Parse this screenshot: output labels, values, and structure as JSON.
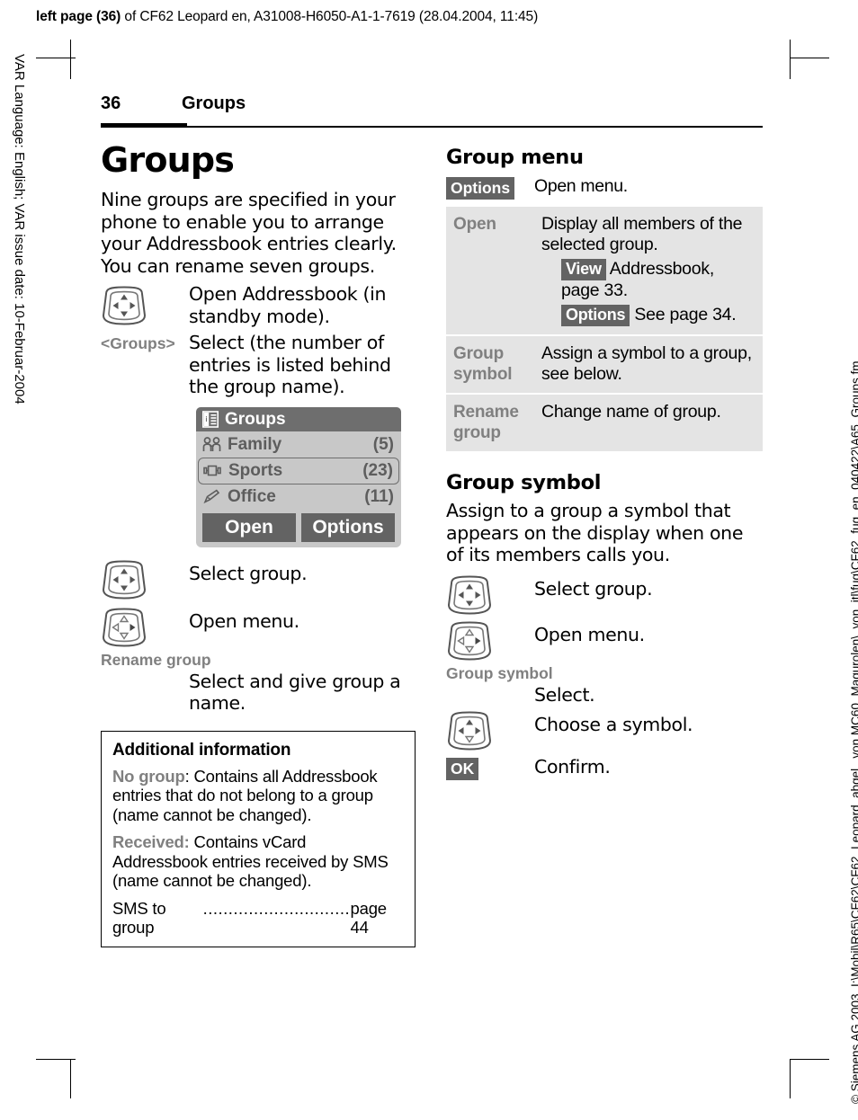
{
  "running_header": {
    "bold_prefix": "left page (36)",
    "rest": " of CF62 Leopard en, A31008-H6050-A1-1-7619 (28.04.2004, 11:45)"
  },
  "margins": {
    "left_vertical": "VAR Language: English; VAR issue date: 10-Februar-2004",
    "right_vertical": "© Siemens AG 2003, I:\\Mobil\\R65\\CF62\\CF62_Leopard_abgel._von MC60_Magurolen\\_von_itl\\fug\\CF62_fug_en_040422\\A65_Groups.fm"
  },
  "page_header": {
    "page_number": "36",
    "chapter": "Groups"
  },
  "left_column": {
    "title": "Groups",
    "intro": "Nine groups are specified in your phone to enable you to arrange your Addressbook entries clearly. You can rename seven groups.",
    "steps": [
      {
        "icon": "nav-key-all-icon",
        "label": "",
        "text": "Open Addressbook (in standby mode)."
      },
      {
        "icon": "",
        "label": "<Groups>",
        "text": "Select (the number of entries is listed behind the group name)."
      }
    ],
    "steps_after": [
      {
        "icon": "nav-key-all-icon",
        "label": "",
        "text": "Select group."
      },
      {
        "icon": "nav-key-right-icon",
        "label": "",
        "text": "Open menu."
      },
      {
        "icon": "",
        "label": "Rename group",
        "text": "Select and give group a name."
      }
    ],
    "phone": {
      "title": "Groups",
      "title_icon": "addressbook-icon",
      "items": [
        {
          "icon": "family-icon",
          "name": "Family",
          "count": "(5)",
          "selected": false
        },
        {
          "icon": "sports-icon",
          "name": "Sports",
          "count": "(23)",
          "selected": true
        },
        {
          "icon": "office-icon",
          "name": "Office",
          "count": "(11)",
          "selected": false
        }
      ],
      "softkey_left": "Open",
      "softkey_right": "Options"
    },
    "infobox": {
      "heading": "Additional information",
      "paragraphs": [
        {
          "label": "No group",
          "label_suffix": ":",
          "text": " Contains all Addressbook entries that do not belong to a group (name cannot be changed)."
        },
        {
          "label": "Received:",
          "label_suffix": "",
          "text": " Contains vCard Addressbook entries received by SMS (name cannot be changed)."
        }
      ],
      "reference": {
        "text": "SMS to group",
        "dots": " ................................",
        "page": "page 44"
      }
    }
  },
  "right_column": {
    "menu_heading": "Group menu",
    "menu_intro": {
      "key": "Options",
      "text": "Open menu."
    },
    "table": [
      {
        "key": "Open",
        "value": "Display all members of the selected group.",
        "sub_rows": [
          {
            "key": "View",
            "text": "Addressbook, page 33."
          },
          {
            "key": "Options",
            "text": "See page 34."
          }
        ]
      },
      {
        "key": "Group symbol",
        "value": "Assign a symbol to a group, see below.",
        "sub_rows": []
      },
      {
        "key": "Rename group",
        "value": "Change name of group.",
        "sub_rows": []
      }
    ],
    "symbol_heading": "Group symbol",
    "symbol_intro": "Assign to a group a symbol that appears on the display when one of its members calls you.",
    "symbol_steps": [
      {
        "icon": "nav-key-all-icon",
        "label": "",
        "text": "Select group."
      },
      {
        "icon": "nav-key-right-icon",
        "label": "",
        "text": "Open menu."
      },
      {
        "icon": "",
        "label": "Group symbol",
        "text": "Select."
      },
      {
        "icon": "nav-key-all-icon",
        "label": "",
        "text": "Choose a symbol."
      },
      {
        "icon": "",
        "softkey": "OK",
        "text": "Confirm."
      }
    ]
  },
  "colors": {
    "softkey_bg": "#636363",
    "table_row_bg": "#e4e4e4",
    "gray_label": "#808080",
    "phone_bg": "#c8c8c8",
    "phone_title_bg": "#6e6e6e"
  }
}
